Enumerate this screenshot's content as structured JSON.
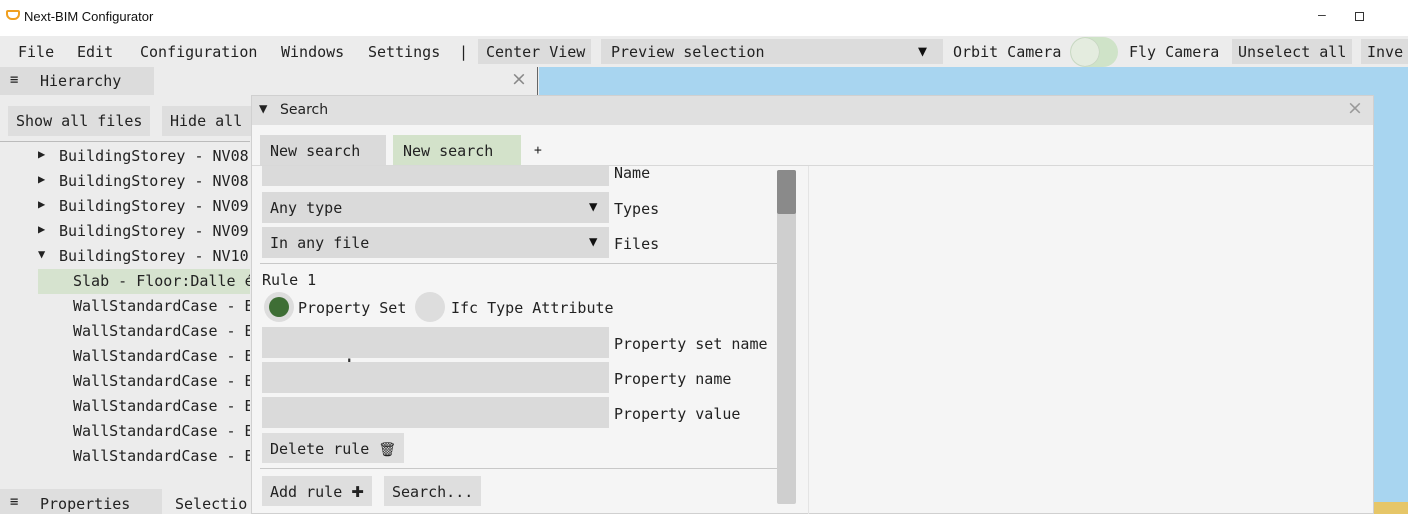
{
  "window": {
    "title": "Next-BIM Configurator",
    "minimize_glyph": "–"
  },
  "menu": {
    "file": "File",
    "edit": "Edit",
    "configuration": "Configuration",
    "windows": "Windows",
    "settings": "Settings",
    "separator": "|",
    "center_view": "Center View",
    "preview_selection": "Preview selection",
    "dropdown_caret": "▼",
    "orbit_camera": "Orbit Camera",
    "fly_camera": "Fly Camera",
    "unselect_all": "Unselect all",
    "invert_partial": "Inve"
  },
  "hierarchy": {
    "icon": "triple-bar-caret-icon",
    "title": "Hierarchy",
    "close": "×",
    "show_all_files": "Show all files",
    "hide_all": "Hide all",
    "tree": [
      {
        "arrow": "▶",
        "label": "BuildingStorey - NV08",
        "indent": 1
      },
      {
        "arrow": "▶",
        "label": "BuildingStorey - NV08-",
        "indent": 1
      },
      {
        "arrow": "▶",
        "label": "BuildingStorey - NV09",
        "indent": 1
      },
      {
        "arrow": "▶",
        "label": "BuildingStorey - NV09-",
        "indent": 1
      },
      {
        "arrow": "▼",
        "label": "BuildingStorey - NV10",
        "indent": 1
      },
      {
        "arrow": "",
        "label": "Slab - Floor:Dalle é",
        "indent": 2,
        "selected": true
      },
      {
        "arrow": "",
        "label": "WallStandardCase - B",
        "indent": 2
      },
      {
        "arrow": "",
        "label": "WallStandardCase - B",
        "indent": 2
      },
      {
        "arrow": "",
        "label": "WallStandardCase - B",
        "indent": 2
      },
      {
        "arrow": "",
        "label": "WallStandardCase - B",
        "indent": 2
      },
      {
        "arrow": "",
        "label": "WallStandardCase - B",
        "indent": 2
      },
      {
        "arrow": "",
        "label": "WallStandardCase - B",
        "indent": 2
      },
      {
        "arrow": "",
        "label": "WallStandardCase - B",
        "indent": 2
      }
    ],
    "properties_tab": "Properties",
    "selection_tab": "Selectio"
  },
  "search": {
    "caret": "▼",
    "title": "Search",
    "close": "×",
    "tabs": [
      "New search",
      "New search",
      "+"
    ],
    "name_label": "Name",
    "types_value": "Any type",
    "types_label": "Types",
    "files_value": "In any file",
    "files_label": "Files",
    "dropdown_caret": "▼",
    "rule_title": "Rule 1",
    "radio_property_set": "Property Set",
    "radio_ifc_type": "Ifc Type Attribute",
    "property_set_name_label": "Property set name",
    "property_name_label": "Property name",
    "property_value_label": "Property value",
    "property_set_name_value": "",
    "property_name_value": "",
    "property_value_value": "",
    "delete_rule": "Delete rule",
    "delete_icon_glyph": "🗑",
    "add_rule": "Add rule",
    "add_icon_glyph": "✚",
    "search_button": "Search..."
  },
  "colors": {
    "viewport_sky": "#a8d5f0",
    "selected_green": "#d6e3cf",
    "radio_on": "#3e6e35"
  }
}
